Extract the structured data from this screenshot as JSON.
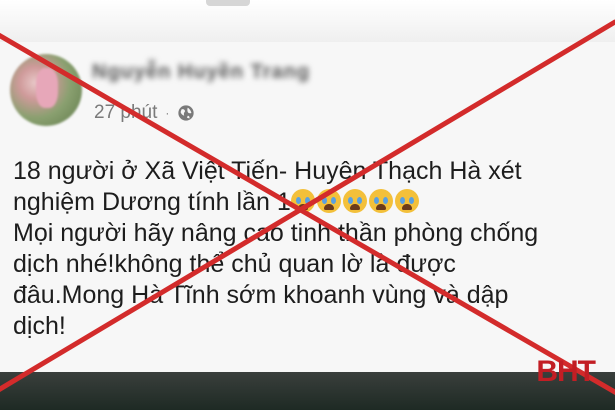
{
  "post": {
    "author": "Nguyễn Huyền Trang",
    "time": "27 phút",
    "separator": "·",
    "privacy_icon": "globe-icon",
    "lines": [
      "18 người ở Xã Việt Tiến- Huyện Thạch Hà xét",
      "nghiệm Dương tính lần 1",
      "Mọi người hãy nâng cao tinh thần phòng chống",
      "dịch nhé!không thể chủ quan lờ là được",
      "đâu.Mong Hà Tĩnh sớm khoanh vùng và dập",
      "dịch!"
    ],
    "emoji_icon": "crying-face-icon"
  },
  "overlay": {
    "watermark": "BHT",
    "cross_color": "#d32b2b"
  }
}
